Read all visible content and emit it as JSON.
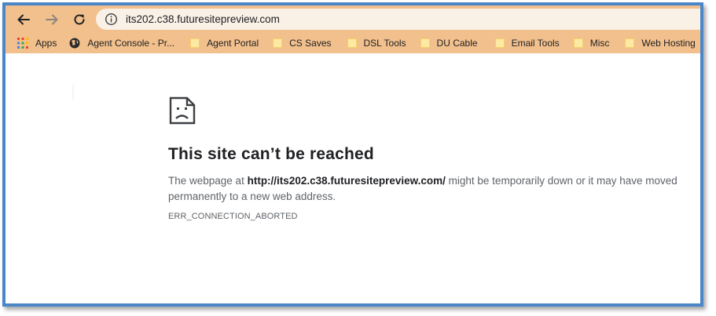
{
  "toolbar": {
    "back_icon": "back-arrow-icon",
    "forward_icon": "forward-arrow-icon",
    "reload_icon": "reload-icon",
    "address": {
      "info_icon": "info-icon",
      "url": "its202.c38.futuresitepreview.com"
    }
  },
  "bookmarks": {
    "items": [
      {
        "label": "Apps",
        "icon": "apps-grid-icon"
      },
      {
        "label": "Agent Console - Pr...",
        "icon": "globe-icon"
      },
      {
        "label": "Agent Portal",
        "icon": "folder-icon"
      },
      {
        "label": "CS Saves",
        "icon": "folder-icon"
      },
      {
        "label": "DSL Tools",
        "icon": "folder-icon"
      },
      {
        "label": "DU Cable",
        "icon": "folder-icon"
      },
      {
        "label": "Email Tools",
        "icon": "folder-icon"
      },
      {
        "label": "Misc",
        "icon": "folder-icon"
      },
      {
        "label": "Web Hosting",
        "icon": "folder-icon"
      }
    ]
  },
  "error_page": {
    "icon": "sad-page-icon",
    "title": "This site can’t be reached",
    "desc_prefix": "The webpage at ",
    "desc_url": "http://its202.c38.futuresitepreview.com/",
    "desc_suffix": " might be temporarily down or it may have moved permanently to a new web address.",
    "error_code": "ERR_CONNECTION_ABORTED"
  },
  "colors": {
    "toolbar_bg": "#f2c08c",
    "omnibox_bg": "#f9f0e6",
    "frame_border": "#4a86c8",
    "folder": "#fce9a2"
  }
}
